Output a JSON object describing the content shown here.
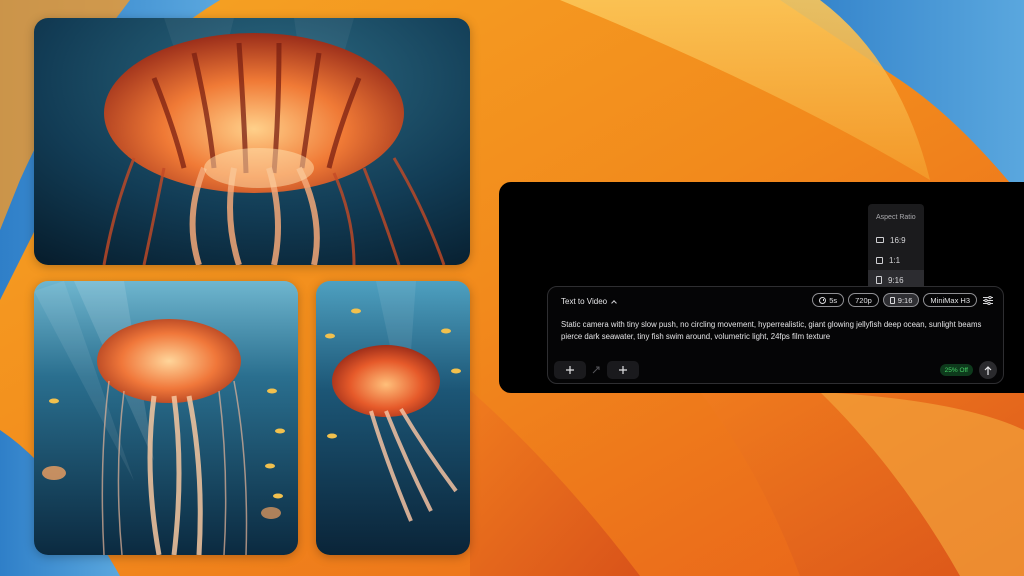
{
  "wallpaper": {
    "colors": {
      "orange": "#f08a1e",
      "blue": "#3d8fd3",
      "light": "#f7b545"
    }
  },
  "gallery": [
    {
      "name": "jellyfish-wide",
      "palette": {
        "bg": "#10354a",
        "body": "#e66a2c"
      }
    },
    {
      "name": "jellyfish-tall-sunbeams",
      "palette": {
        "bg": "#1f5a78",
        "body": "#f07a3a"
      }
    },
    {
      "name": "jellyfish-narrow",
      "palette": {
        "bg": "#113a56",
        "body": "#e2542a"
      }
    }
  ],
  "aspect_menu": {
    "title": "Aspect Ratio",
    "options": [
      {
        "label": "16:9",
        "icon": "landscape-ratio-icon"
      },
      {
        "label": "1:1",
        "icon": "square-ratio-icon"
      },
      {
        "label": "9:16",
        "icon": "portrait-ratio-icon"
      }
    ],
    "selected": "9:16"
  },
  "composer": {
    "mode": "Text to Video",
    "duration": "5s",
    "resolution": "720p",
    "aspect": "9:16",
    "model": "MiniMax H3",
    "prompt": "Static camera with tiny slow push, no circling movement, hyperrealistic, giant glowing jellyfish deep ocean, sunlight beams pierce dark seawater, tiny fish swim around, volumetric light, 24fps film texture",
    "discount": "25% Off",
    "add_icon": "plus-icon",
    "send_icon": "arrow-up-icon",
    "colors": {
      "discount_bg": "#0e3a1c",
      "discount_text": "#46d266"
    }
  }
}
